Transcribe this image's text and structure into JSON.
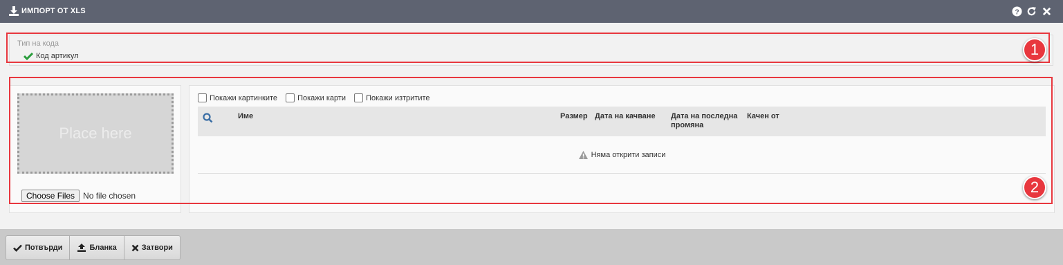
{
  "window": {
    "title": "ИМПОРТ ОТ XLS",
    "icons": [
      "download-icon",
      "help-icon",
      "refresh-icon",
      "close-icon"
    ]
  },
  "code_type": {
    "label": "Тип на кода",
    "selected_option": "Код артикул"
  },
  "upload": {
    "dropzone_text": "Place here",
    "choose_button": "Choose Files",
    "file_status": "No file chosen"
  },
  "files": {
    "checkboxes": [
      {
        "label": "Покажи картинките",
        "checked": false
      },
      {
        "label": "Покажи карти",
        "checked": false
      },
      {
        "label": "Покажи изтритите",
        "checked": false
      }
    ],
    "columns": {
      "name": "Име",
      "size": "Размер",
      "uploaded_on": "Дата на качване",
      "modified_on": "Дата на последна промяна",
      "uploaded_by": "Качен от"
    },
    "empty_message": "Няма открити записи"
  },
  "annotations": {
    "badge_1": "1",
    "badge_2": "2",
    "color": "#e8373e"
  },
  "footer": {
    "confirm": "Потвърди",
    "template": "Бланка",
    "close": "Затвори"
  },
  "colors": {
    "titlebar": "#5e6371",
    "check_green": "#2a9d3c",
    "search_blue": "#3a6ea5"
  }
}
